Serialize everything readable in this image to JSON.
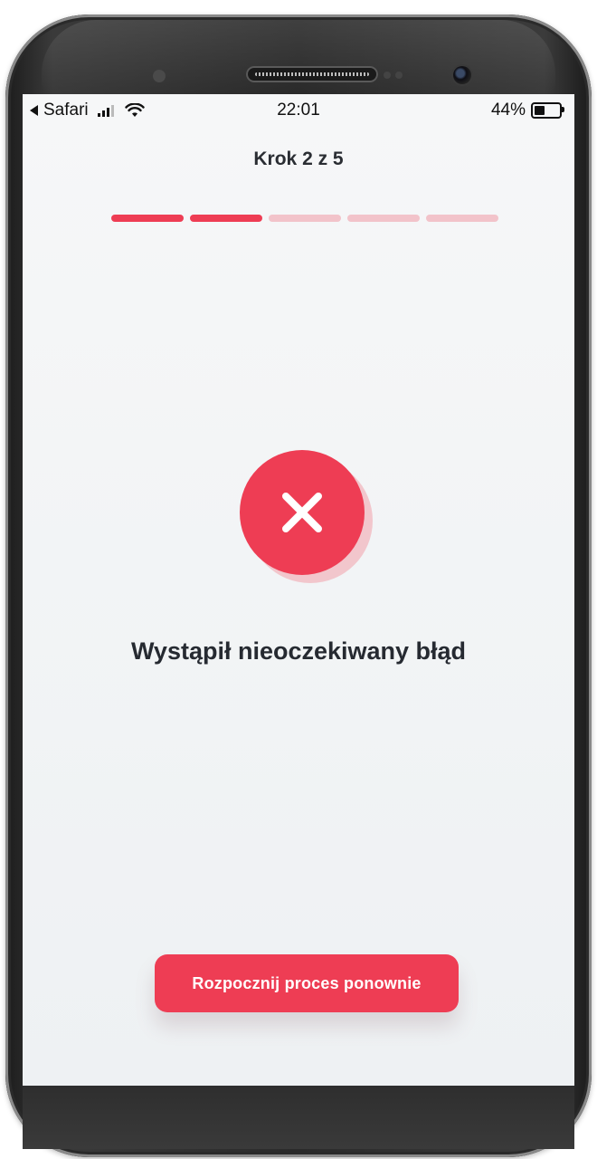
{
  "status_bar": {
    "app": "Safari",
    "time": "22:01",
    "battery": "44%"
  },
  "header": {
    "step_label": "Krok 2 z 5"
  },
  "progress": {
    "total_steps": 5,
    "current_step": 2,
    "active_color": "#ee3d54",
    "inactive_color": "#f2c3ca"
  },
  "error": {
    "icon": "close-icon",
    "message": "Wystąpił nieoczekiwany błąd"
  },
  "actions": {
    "restart_label": "Rozpocznij proces ponownie"
  },
  "colors": {
    "accent": "#ee3d54",
    "text": "#262a31"
  }
}
